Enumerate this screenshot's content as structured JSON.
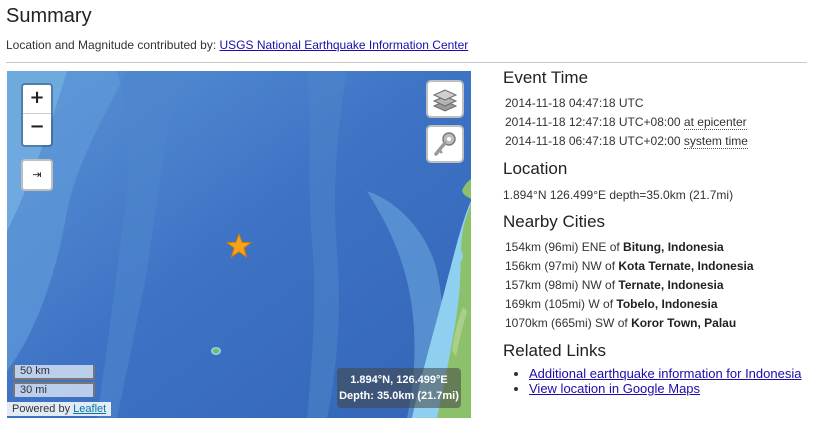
{
  "title": "Summary",
  "attribution": {
    "prefix": "Location and Magnitude contributed by:",
    "link": "USGS National Earthquake Information Center"
  },
  "map": {
    "zoom_in_label": "+",
    "zoom_out_label": "−",
    "fullscreen_icon": "fullscreen-toggle-icon",
    "layers_icon": "layers-icon",
    "key_icon": "key-icon",
    "marker_icon": "star-icon",
    "scale_km": "50 km",
    "scale_mi": "30 mi",
    "powered_prefix": "Powered by",
    "powered_link": "Leaflet",
    "coords_line1": "1.894°N, 126.499°E",
    "coords_line2": "Depth: 35.0km (21.7mi)",
    "colors": {
      "ocean": "#3a6fc0",
      "shallow": "#8fd0f0",
      "land": "#8cc06a",
      "star": "#f6a21b"
    }
  },
  "event_time": {
    "heading": "Event Time",
    "utc": "2014-11-18 04:47:18 UTC",
    "epicenter_time": "2014-11-18 12:47:18 UTC+08:00",
    "epicenter_label": "at epicenter",
    "system_time": "2014-11-18 06:47:18 UTC+02:00",
    "system_label": "system time"
  },
  "location": {
    "heading": "Location",
    "text": "1.894°N 126.499°E depth=35.0km (21.7mi)"
  },
  "nearby": {
    "heading": "Nearby Cities",
    "cities": [
      {
        "dist": "154km (96mi) ENE of",
        "name": "Bitung, Indonesia"
      },
      {
        "dist": "156km (97mi) NW of",
        "name": "Kota Ternate, Indonesia"
      },
      {
        "dist": "157km (98mi) NW of",
        "name": "Ternate, Indonesia"
      },
      {
        "dist": "169km (105mi) W of",
        "name": "Tobelo, Indonesia"
      },
      {
        "dist": "1070km (665mi) SW of",
        "name": "Koror Town, Palau"
      }
    ]
  },
  "related": {
    "heading": "Related Links",
    "links": [
      "Additional earthquake information for Indonesia",
      "View location in Google Maps"
    ]
  }
}
